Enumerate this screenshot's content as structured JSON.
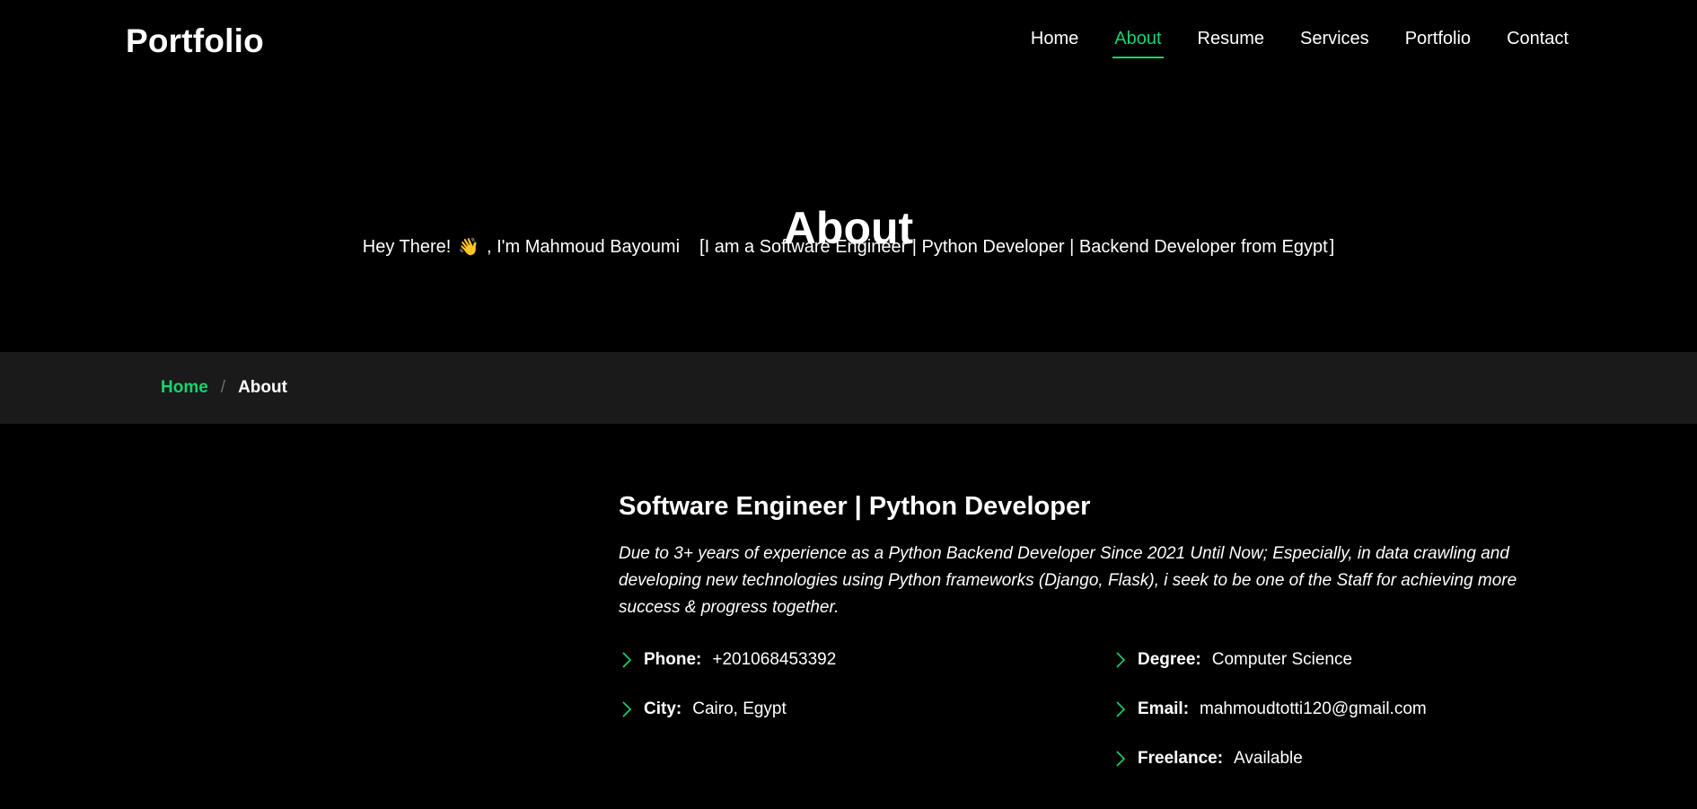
{
  "header": {
    "logo": "Portfolio",
    "nav": [
      "Home",
      "About",
      "Resume",
      "Services",
      "Portfolio",
      "Contact"
    ],
    "active": "About"
  },
  "hero": {
    "title": "About",
    "greeting_prefix": "Hey There!",
    "greeting_emoji": "👋",
    "greeting_suffix": ", I'm Mahmoud Bayoumi",
    "typed_open": "[",
    "typed_text": "I am a Software Engineer | Python Developer | Backend Developer from Egypt",
    "typed_close": "]"
  },
  "breadcrumb": {
    "home": "Home",
    "separator": "/",
    "current": "About"
  },
  "about": {
    "heading": "Software Engineer | Python Developer",
    "description": "Due to 3+ years of experience as a Python Backend Developer Since 2021 Until Now; Especially, in data crawling and developing new technologies using Python frameworks (Django, Flask), i seek to be one of the Staff for achieving more success & progress together.",
    "info": {
      "phone": {
        "label": "Phone:",
        "value": "+201068453392"
      },
      "city": {
        "label": "City:",
        "value": "Cairo, Egypt"
      },
      "degree": {
        "label": "Degree:",
        "value": "Computer Science"
      },
      "email": {
        "label": "Email:",
        "value": "mahmoudtotti120@gmail.com"
      },
      "freelance": {
        "label": "Freelance:",
        "value": "Available"
      }
    }
  },
  "colors": {
    "accent": "#18d26e",
    "background": "#000000",
    "breadcrumb_bar": "#1a1a1a"
  },
  "icons": {
    "info_bullet": "chevron-right-icon"
  }
}
